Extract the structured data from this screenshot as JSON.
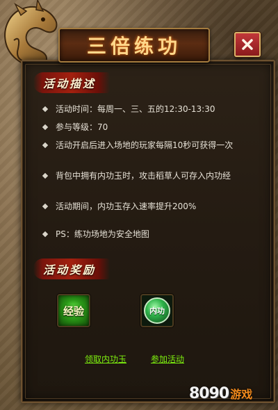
{
  "window": {
    "title": "三倍练功",
    "close_label": "✕"
  },
  "sections": {
    "description_title": "活动描述",
    "reward_title": "活动奖励"
  },
  "description_items": [
    "活动时间：每周一、三、五的12:30-13:30",
    "参与等级：70",
    "活动开启后进入场地的玩家每隔10秒可获得一次",
    "背包中拥有内功玉时，攻击稻草人可存入内功经",
    "活动期间，内功玉存入速率提升200%",
    "PS：练功场地为安全地图"
  ],
  "rewards": [
    {
      "label": "经验",
      "icon": "exp-icon"
    },
    {
      "label": "内功",
      "icon": "neigong-orb-icon"
    }
  ],
  "links": {
    "claim": "领取内功玉",
    "join": "参加活动"
  },
  "watermark": {
    "number": "8090",
    "text": "游戏"
  },
  "colors": {
    "link": "#7ef00f",
    "title": "#ffd78a",
    "banner": "#a3200f"
  }
}
